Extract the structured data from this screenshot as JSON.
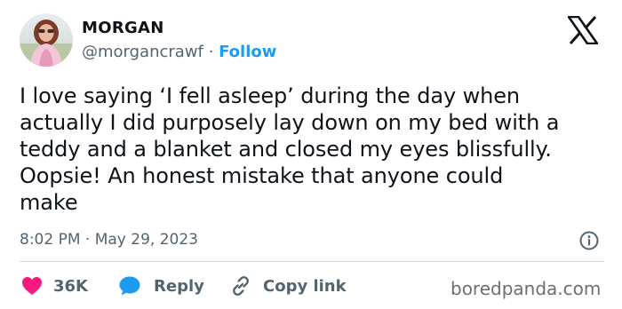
{
  "user": {
    "name": "MORGAN",
    "handle": "@morgancrawf",
    "separator": "·",
    "follow_label": "Follow"
  },
  "tweet": {
    "lines": [
      "I love saying ‘I fell asleep’ during the day when",
      "actually I did purposely lay down on my bed with a",
      "teddy and a blanket and closed my eyes blissfully.",
      "Oopsie! An honest mistake that anyone could",
      "make"
    ],
    "timestamp": "8:02 PM · May 29, 2023"
  },
  "actions": {
    "like_count": "36K",
    "reply_label": "Reply",
    "copy_link_label": "Copy link"
  },
  "icons": {
    "logo": "x-logo-icon",
    "info": "info-icon",
    "like": "heart-icon",
    "reply": "speech-bubble-icon",
    "copy": "link-icon"
  },
  "colors": {
    "text_primary": "#0f1419",
    "text_secondary": "#536471",
    "accent_blue": "#1d9bf0",
    "like_pink": "#f91880",
    "divider": "#cfd9de"
  },
  "watermark": "boredpanda.com"
}
